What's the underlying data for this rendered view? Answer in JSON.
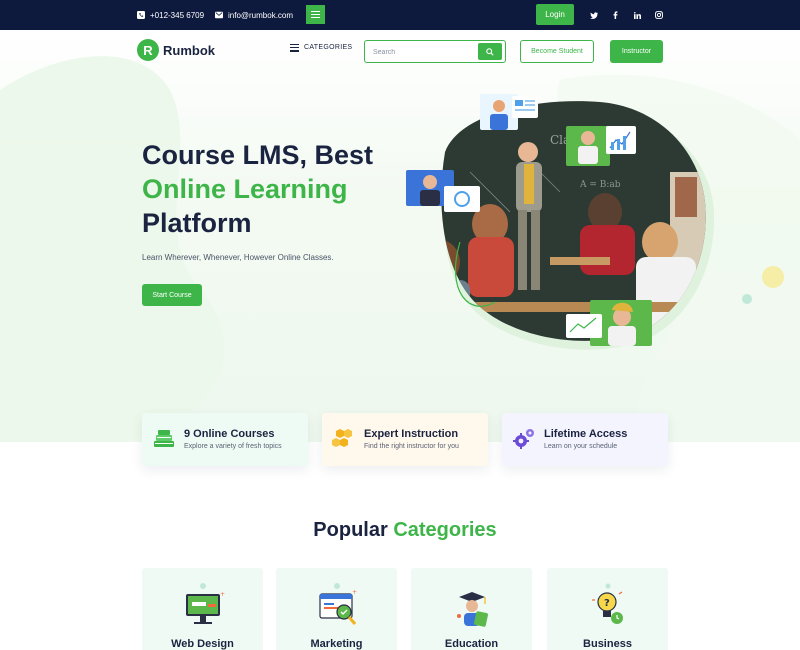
{
  "topbar": {
    "phone": "+012-345 6709",
    "email": "info@rumbok.com",
    "login_label": "Login",
    "social": [
      "twitter-icon",
      "facebook-icon",
      "linkedin-icon",
      "instagram-icon"
    ]
  },
  "header": {
    "logo_letter": "R",
    "logo_text": "Rumbok",
    "categories_label": "CATEGORIES",
    "search_placeholder": "Search",
    "become_student_label": "Become Student",
    "instructor_label": "Instructor"
  },
  "hero": {
    "title_line1": "Course LMS, Best",
    "title_line2": "Online Learning",
    "title_line3": "Platform",
    "subtitle": "Learn Wherever, Whenever, However Online Classes.",
    "cta_label": "Start Course"
  },
  "features": [
    {
      "title": "9 Online Courses",
      "subtitle": "Explore a variety of fresh topics",
      "icon": "books-icon"
    },
    {
      "title": "Expert Instruction",
      "subtitle": "Find the right instructor for you",
      "icon": "hexagons-icon"
    },
    {
      "title": "Lifetime Access",
      "subtitle": "Learn on your schedule",
      "icon": "gears-icon"
    }
  ],
  "popular": {
    "title_part1": "Popular",
    "title_part2": "Categories",
    "categories": [
      {
        "label": "Web Design",
        "icon": "monitor-design-icon"
      },
      {
        "label": "Marketing",
        "icon": "marketing-search-icon"
      },
      {
        "label": "Education",
        "icon": "graduate-icon"
      },
      {
        "label": "Business",
        "icon": "idea-bulb-icon"
      }
    ]
  },
  "colors": {
    "brand_green": "#3eb549",
    "navy": "#0d1a3d",
    "heading": "#1a2340"
  }
}
